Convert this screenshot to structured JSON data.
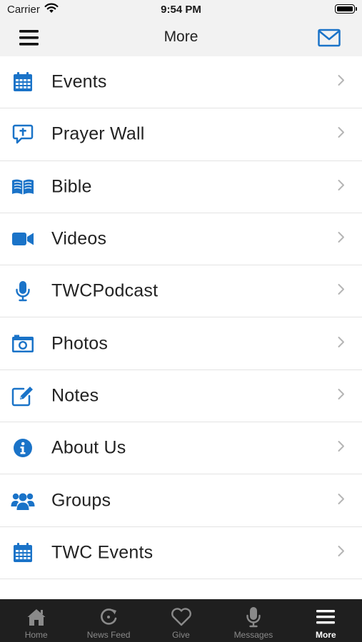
{
  "status_bar": {
    "carrier": "Carrier",
    "time": "9:54 PM"
  },
  "header": {
    "title": "More",
    "left_icon": "hamburger-menu-icon",
    "right_icon": "mail-icon"
  },
  "accent_color": "#1a73c8",
  "menu": [
    {
      "label": "Events",
      "icon": "calendar-icon"
    },
    {
      "label": "Prayer Wall",
      "icon": "prayer-bubble-icon"
    },
    {
      "label": "Bible",
      "icon": "open-book-icon"
    },
    {
      "label": "Videos",
      "icon": "video-camera-icon"
    },
    {
      "label": "TWCPodcast",
      "icon": "microphone-icon"
    },
    {
      "label": "Photos",
      "icon": "camera-icon"
    },
    {
      "label": "Notes",
      "icon": "edit-note-icon"
    },
    {
      "label": "About Us",
      "icon": "info-icon"
    },
    {
      "label": "Groups",
      "icon": "group-icon"
    },
    {
      "label": "TWC Events",
      "icon": "calendar-icon"
    }
  ],
  "tabs": [
    {
      "label": "Home",
      "icon": "home-icon"
    },
    {
      "label": "News Feed",
      "icon": "refresh-icon"
    },
    {
      "label": "Give",
      "icon": "heart-icon"
    },
    {
      "label": "Messages",
      "icon": "microphone-icon"
    },
    {
      "label": "More",
      "icon": "hamburger-menu-icon",
      "active": true
    }
  ]
}
